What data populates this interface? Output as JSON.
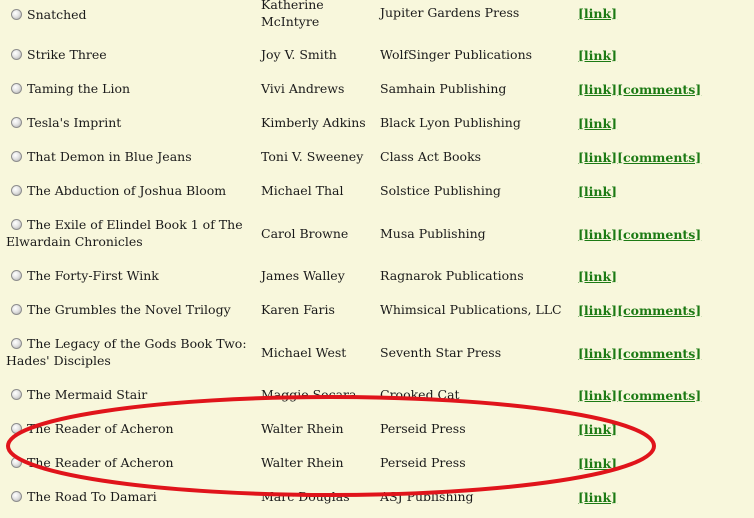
{
  "books": [
    {
      "title": "Snatched",
      "author": "Katherine McIntyre",
      "publisher": "Jupiter Gardens Press",
      "links": [
        "[link]"
      ]
    },
    {
      "title": "Strike Three",
      "author": "Joy V. Smith",
      "publisher": "WolfSinger Publications",
      "links": [
        "[link]"
      ]
    },
    {
      "title": "Taming the Lion",
      "author": "Vivi Andrews",
      "publisher": "Samhain Publishing",
      "links": [
        "[link]",
        "[comments]"
      ]
    },
    {
      "title": "Tesla's Imprint",
      "author": "Kimberly Adkins",
      "publisher": "Black Lyon Publishing",
      "links": [
        "[link]"
      ]
    },
    {
      "title": "That Demon in Blue Jeans",
      "author": "Toni V. Sweeney",
      "publisher": "Class Act Books",
      "links": [
        "[link]",
        "[comments]"
      ]
    },
    {
      "title": "The Abduction of Joshua Bloom",
      "author": "Michael Thal",
      "publisher": "Solstice Publishing",
      "links": [
        "[link]"
      ]
    },
    {
      "title": "The Exile of Elindel Book 1 of The Elwardain Chronicles",
      "author": "Carol Browne",
      "publisher": "Musa Publishing",
      "links": [
        "[link]",
        "[comments]"
      ]
    },
    {
      "title": "The Forty-First Wink",
      "author": "James Walley",
      "publisher": "Ragnarok Publications",
      "links": [
        "[link]"
      ]
    },
    {
      "title": "The Grumbles the Novel Trilogy",
      "author": "Karen Faris",
      "publisher": "Whimsical Publications, LLC",
      "links": [
        "[link]",
        "[comments]"
      ]
    },
    {
      "title": "The Legacy of the Gods Book Two: Hades' Disciples",
      "author": "Michael West",
      "publisher": "Seventh Star Press",
      "links": [
        "[link]",
        "[comments]"
      ]
    },
    {
      "title": "The Mermaid Stair",
      "author": "Maggie Secara",
      "publisher": "Crooked Cat",
      "links": [
        "[link]",
        "[comments]"
      ]
    },
    {
      "title": "The Reader of Acheron",
      "author": "Walter Rhein",
      "publisher": "Perseid Press",
      "links": [
        "[link]"
      ]
    },
    {
      "title": "The Reader of Acheron",
      "author": "Walter Rhein",
      "publisher": "Perseid Press",
      "links": [
        "[link]"
      ]
    },
    {
      "title": "The Road To Damari",
      "author": "Marc Douglas",
      "publisher": "ASJ Publishing",
      "links": [
        "[link]"
      ]
    }
  ],
  "colors": {
    "background": "#f8f7dc",
    "link": "#1c7a14",
    "annotation": "#e0141b"
  }
}
